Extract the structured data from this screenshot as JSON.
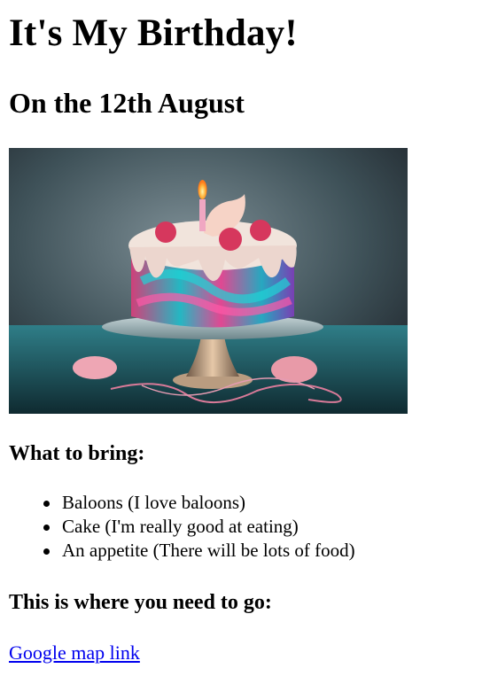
{
  "header": {
    "title": "It's My Birthday!",
    "subtitle": "On the 12th August"
  },
  "image": {
    "alt": "Birthday cake illustration"
  },
  "bring": {
    "heading": "What to bring:",
    "items": [
      "Baloons (I love baloons)",
      "Cake (I'm really good at eating)",
      "An appetite (There will be lots of food)"
    ]
  },
  "directions": {
    "heading": "This is where you need to go:",
    "link_label": "Google map link"
  },
  "colors": {
    "link": "#0000ee",
    "text": "#000000",
    "background": "#ffffff"
  }
}
